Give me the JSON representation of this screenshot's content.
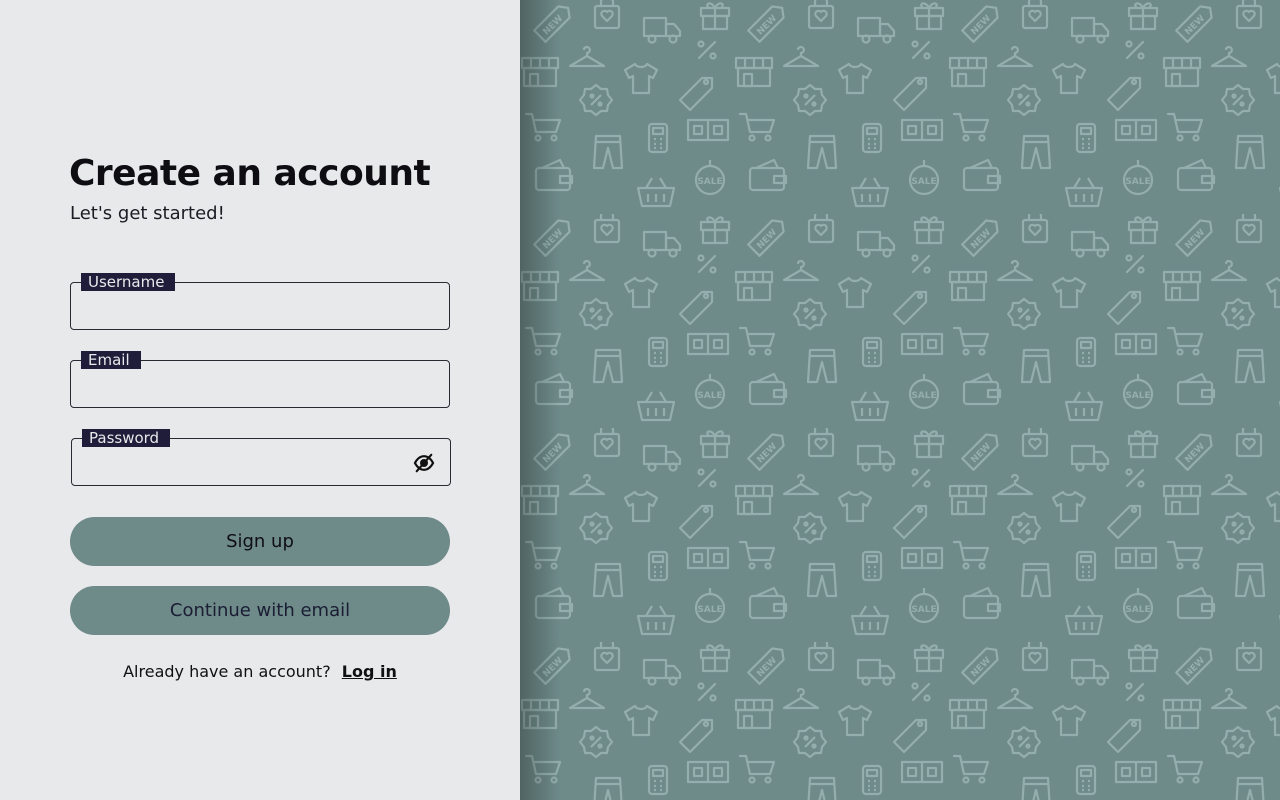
{
  "form": {
    "title": "Create an account",
    "subtitle": "Let's get started!",
    "fields": {
      "username": {
        "label": "Username",
        "value": ""
      },
      "email": {
        "label": "Email",
        "value": ""
      },
      "password": {
        "label": "Password",
        "value": "",
        "toggle_icon": "eye-off-icon"
      }
    },
    "signup_label": "Sign up",
    "continue_email_label": "Continue with email",
    "login_prompt": "Already have an account?",
    "login_link": "Log in"
  },
  "theme": {
    "background": "#e8e9eb",
    "accent": "#6e8a89",
    "label_bg": "#1f1d3a"
  },
  "pattern": {
    "icons": [
      "new-tag-icon",
      "shopping-bag-icon",
      "delivery-truck-icon",
      "gift-icon",
      "percent-icon",
      "hanger-icon",
      "tshirt-icon",
      "price-tag-icon",
      "storefront-icon",
      "discount-badge-icon",
      "shopping-cart-icon",
      "jeans-icon",
      "calculator-icon",
      "cash-icon",
      "sale-tag-icon",
      "wallet-icon",
      "basket-icon"
    ]
  }
}
